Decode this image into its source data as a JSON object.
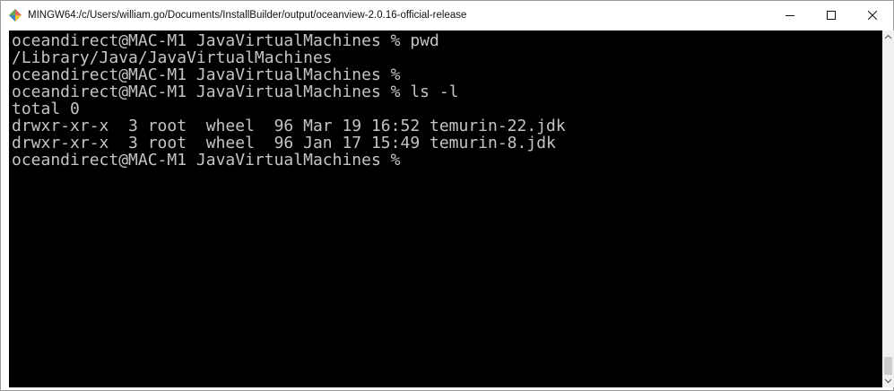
{
  "window": {
    "title": "MINGW64:/c/Users/william.go/Documents/InstallBuilder/output/oceanview-2.0.16-official-release",
    "app_icon": "mingw-diamond-icon",
    "controls": [
      "minimize-icon",
      "maximize-icon",
      "close-icon"
    ]
  },
  "terminal": {
    "background": "#000000",
    "foreground": "#c4c4c4",
    "lines": [
      "oceandirect@MAC-M1 JavaVirtualMachines % pwd",
      "/Library/Java/JavaVirtualMachines",
      "oceandirect@MAC-M1 JavaVirtualMachines %",
      "oceandirect@MAC-M1 JavaVirtualMachines % ls -l",
      "total 0",
      "drwxr-xr-x  3 root  wheel  96 Mar 19 16:52 temurin-22.jdk",
      "drwxr-xr-x  3 root  wheel  96 Jan 17 15:49 temurin-8.jdk",
      "oceandirect@MAC-M1 JavaVirtualMachines %"
    ]
  },
  "scrollbar": {
    "up_icon": "scroll-up-arrow-icon",
    "down_icon": "scroll-down-arrow-icon"
  }
}
